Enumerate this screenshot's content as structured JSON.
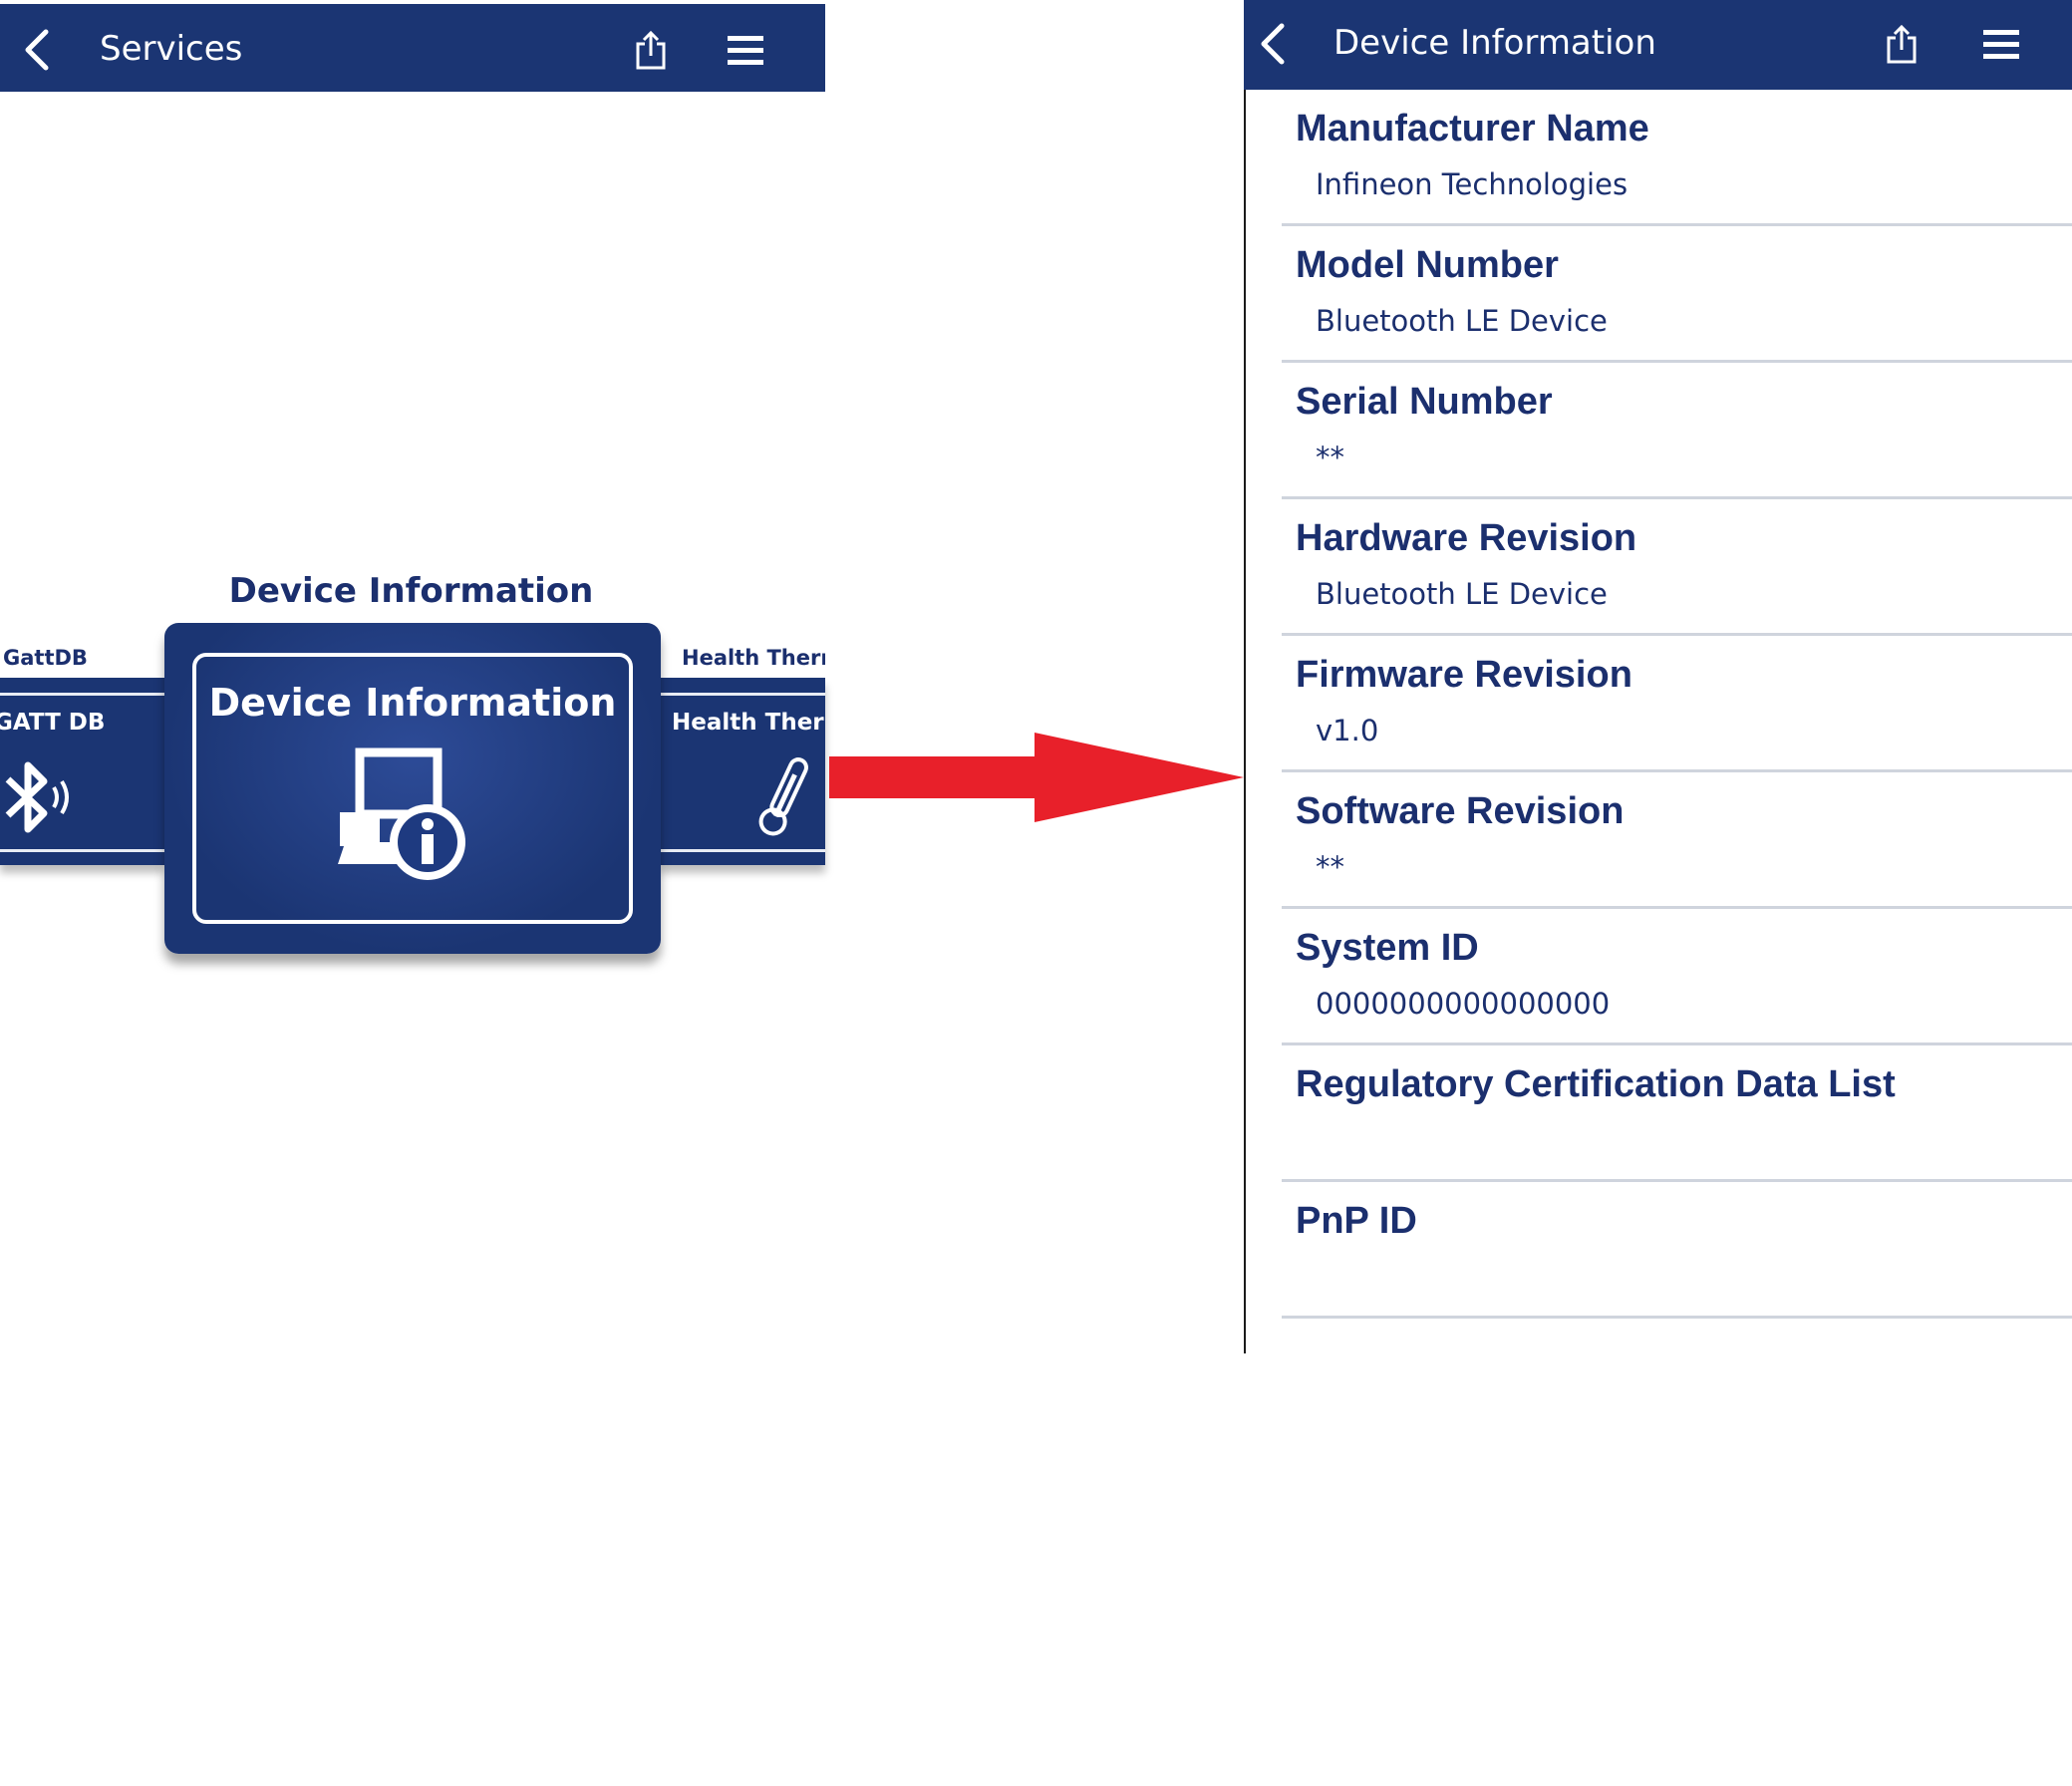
{
  "left_screen": {
    "header": {
      "title": "Services"
    },
    "carousel": {
      "caption": "Device Information",
      "left_neighbor": {
        "caption": "GattDB",
        "card_title": "GATT DB",
        "icon": "bluetooth-icon"
      },
      "current": {
        "card_title": "Device Information",
        "icon": "device-info-icon"
      },
      "right_neighbor": {
        "caption": "Health Thermo",
        "card_title": "Health Therm",
        "icon": "thermometer-icon"
      }
    }
  },
  "right_screen": {
    "header": {
      "title": "Device Information"
    },
    "fields": [
      {
        "label": "Manufacturer Name",
        "value": "Infineon Technologies"
      },
      {
        "label": "Model Number",
        "value": "Bluetooth LE Device"
      },
      {
        "label": "Serial Number",
        "value": "**"
      },
      {
        "label": "Hardware Revision",
        "value": "Bluetooth LE Device"
      },
      {
        "label": "Firmware Revision",
        "value": "v1.0"
      },
      {
        "label": "Software Revision",
        "value": "**"
      },
      {
        "label": "System ID",
        "value": "0000000000000000"
      },
      {
        "label": "Regulatory Certification Data List",
        "value": ""
      },
      {
        "label": "PnP ID",
        "value": ""
      }
    ]
  },
  "colors": {
    "header": "#1b3573",
    "text": "#1b2f6e",
    "arrow": "#e8202a",
    "divider": "#cfd4dd"
  }
}
